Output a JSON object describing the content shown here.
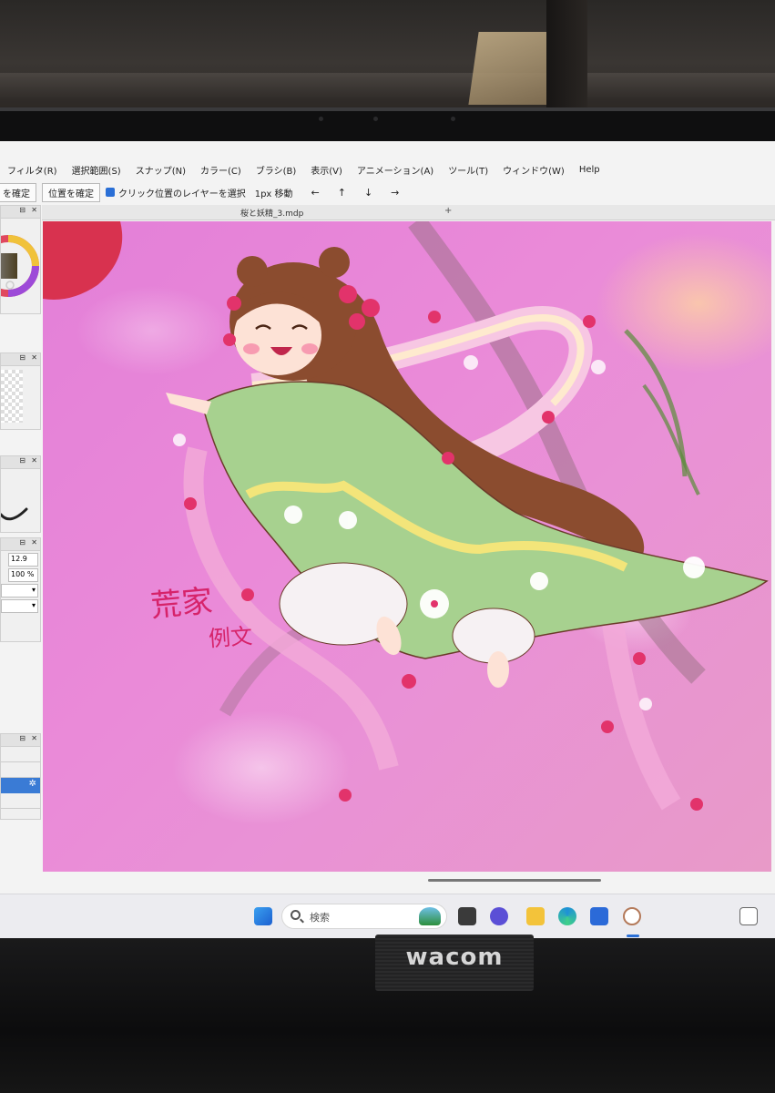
{
  "menu": {
    "items": [
      "フィルタ(R)",
      "選択範囲(S)",
      "スナップ(N)",
      "カラー(C)",
      "ブラシ(B)",
      "表示(V)",
      "アニメーション(A)",
      "ツール(T)",
      "ウィンドウ(W)",
      "Help"
    ]
  },
  "toolbar": {
    "confirm_label": "を確定",
    "position_confirm_label": "位置を確定",
    "click_select_label": "クリック位置のレイヤーを選択",
    "move_label": "1px 移動"
  },
  "document": {
    "tab_title": "桜と妖精_3.mdp",
    "close_glyph": "+"
  },
  "left_panel": {
    "brush_size_value": "12.9",
    "opacity_value": "100 %",
    "panel_button_glyph": "⊟",
    "close_glyph": "✕"
  },
  "artwork": {
    "signature_line1": "荒家",
    "signature_line2": "例文"
  },
  "taskbar": {
    "search_placeholder": "検索"
  },
  "device": {
    "brand": "wacom"
  },
  "colors": {
    "canvas_pink": "#e584d8",
    "kimono_green": "#a7d18f",
    "hair_brown": "#8b4c2f",
    "accent_blue": "#2a6fd6"
  }
}
